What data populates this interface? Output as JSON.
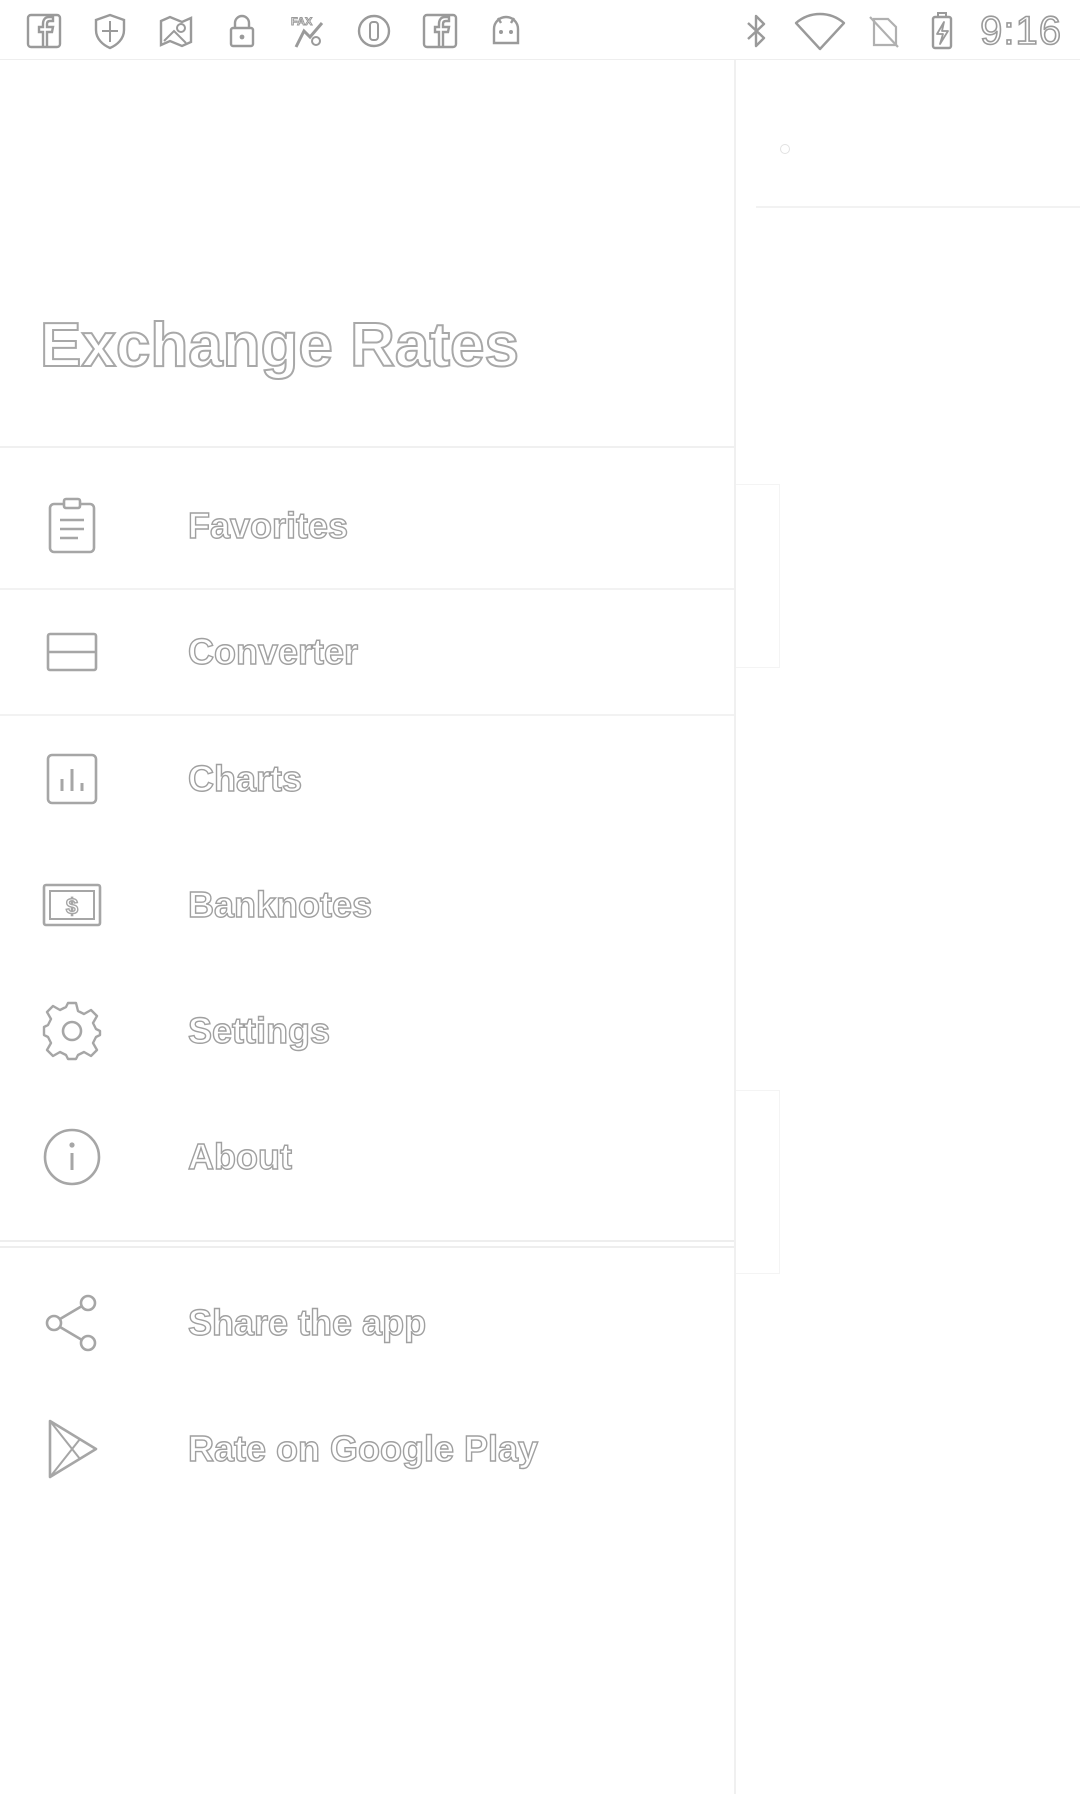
{
  "status_bar": {
    "left_icons": [
      "facebook-icon",
      "shield-icon",
      "map-icon",
      "lock-icon",
      "fax-icon",
      "circle-icon",
      "facebook-icon",
      "android-icon"
    ],
    "right_icons": [
      "bluetooth-icon",
      "wifi-icon",
      "no-sim-icon",
      "battery-charging-icon"
    ],
    "time": "9:16"
  },
  "drawer": {
    "title": "Exchange Rates",
    "primary_items": [
      {
        "label": "Favorites",
        "icon": "clipboard-list-icon"
      },
      {
        "label": "Converter",
        "icon": "converter-icon"
      },
      {
        "label": "Charts",
        "icon": "bar-chart-icon"
      },
      {
        "label": "Banknotes",
        "icon": "banknote-icon"
      },
      {
        "label": "Settings",
        "icon": "gear-icon"
      },
      {
        "label": "About",
        "icon": "info-icon"
      }
    ],
    "secondary_items": [
      {
        "label": "Share the app",
        "icon": "share-icon"
      },
      {
        "label": "Rate on Google Play",
        "icon": "play-store-icon"
      }
    ]
  }
}
